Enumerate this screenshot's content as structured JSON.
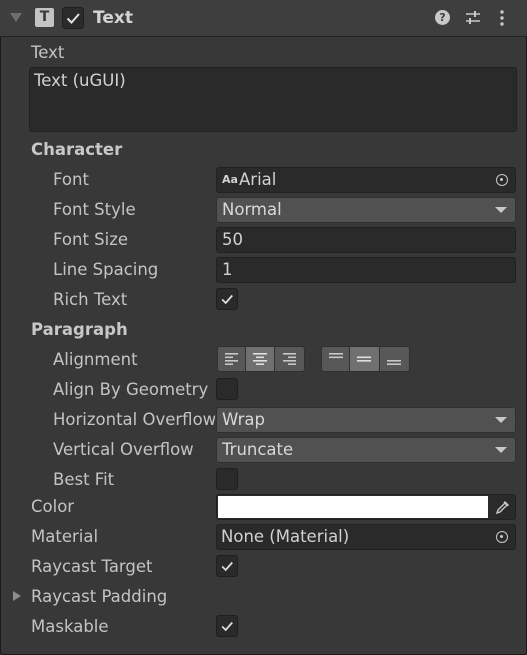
{
  "header": {
    "component_icon_letter": "T",
    "title": "Text",
    "enabled": true,
    "icons": [
      "help-icon",
      "presets-icon",
      "more-icon"
    ]
  },
  "text": {
    "label": "Text",
    "value": "Text (uGUI)"
  },
  "character": {
    "section_label": "Character",
    "font_label": "Font",
    "font_icon": "Aa",
    "font_value": "Arial",
    "font_style_label": "Font Style",
    "font_style_value": "Normal",
    "font_size_label": "Font Size",
    "font_size_value": "50",
    "line_spacing_label": "Line Spacing",
    "line_spacing_value": "1",
    "rich_text_label": "Rich Text",
    "rich_text_checked": true
  },
  "paragraph": {
    "section_label": "Paragraph",
    "alignment_label": "Alignment",
    "horizontal_alignment_selected": "center",
    "vertical_alignment_selected": "middle",
    "align_by_geometry_label": "Align By Geometry",
    "align_by_geometry_checked": false,
    "horizontal_overflow_label": "Horizontal Overflow",
    "horizontal_overflow_value": "Wrap",
    "vertical_overflow_label": "Vertical Overflow",
    "vertical_overflow_value": "Truncate",
    "best_fit_label": "Best Fit",
    "best_fit_checked": false
  },
  "color": {
    "label": "Color",
    "value_hex": "#ffffff"
  },
  "material": {
    "label": "Material",
    "value": "None (Material)"
  },
  "raycast_target": {
    "label": "Raycast Target",
    "checked": true
  },
  "raycast_padding": {
    "label": "Raycast Padding"
  },
  "maskable": {
    "label": "Maskable",
    "checked": true
  }
}
